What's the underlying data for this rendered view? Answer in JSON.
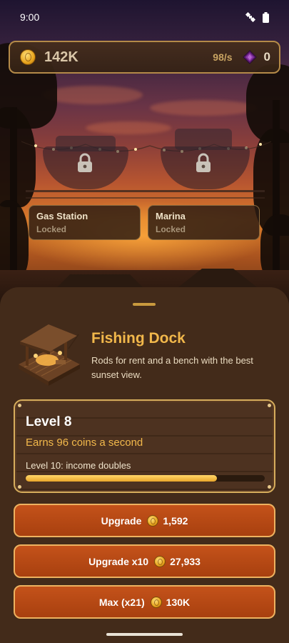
{
  "status_bar": {
    "time": "9:00"
  },
  "hud": {
    "coins": "142K",
    "rate": "98/s",
    "gems": "0"
  },
  "locked_buildings": [
    {
      "name": "Gas Station",
      "state": "Locked"
    },
    {
      "name": "Marina",
      "state": "Locked"
    }
  ],
  "building": {
    "name": "Fishing Dock",
    "description": "Rods for rent and a bench with the best sunset view.",
    "level": "Level 8",
    "earnings": "Earns 96 coins a second",
    "milestone": "Level 10: income doubles",
    "progress": 0.8
  },
  "buttons": [
    {
      "label": "Upgrade",
      "cost": "1,592"
    },
    {
      "label": "Upgrade x10",
      "cost": "27,933"
    },
    {
      "label": "Max (x21)",
      "cost": "130K"
    }
  ],
  "colors": {
    "accent_gold": "#f2b84b",
    "button_orange": "#b8481a",
    "sheet_brown": "#432b1a"
  },
  "icons": [
    "gold-coin-icon",
    "purple-gem-icon",
    "lock-icon",
    "satellite-icon",
    "battery-icon"
  ]
}
